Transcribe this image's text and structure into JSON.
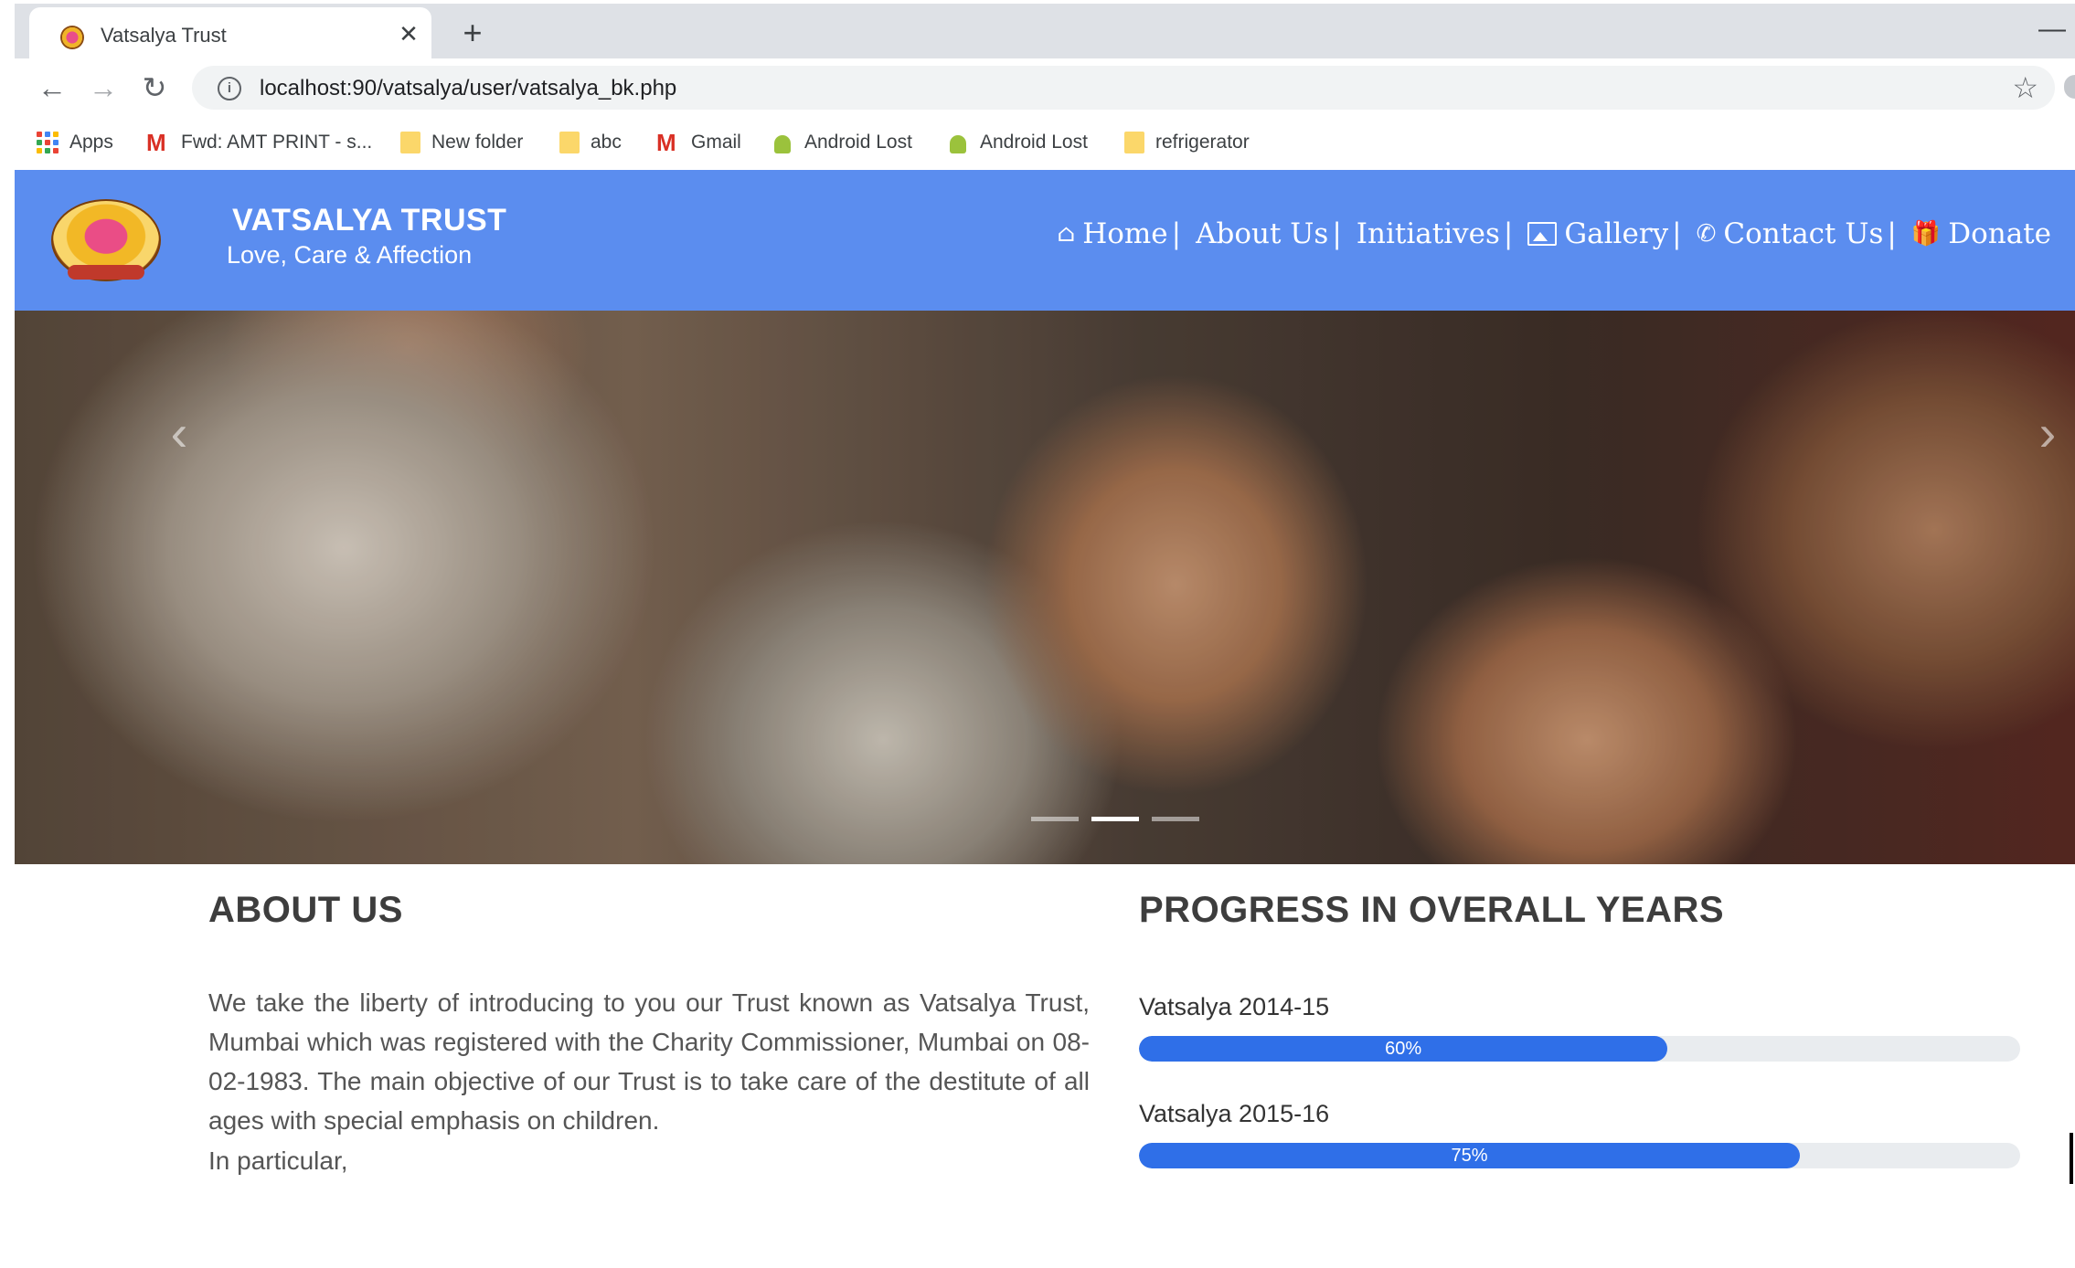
{
  "browser": {
    "tab_title": "Vatsalya Trust",
    "tab_close": "✕",
    "new_tab": "+",
    "minimize": "—",
    "url": "localhost:90/vatsalya/user/vatsalya_bk.php",
    "info": "i",
    "star": "☆",
    "nav": {
      "back": "←",
      "forward": "→",
      "reload": "↻"
    },
    "bookmarks": [
      {
        "label": "Apps",
        "icon": "apps-grid-icon"
      },
      {
        "label": "Fwd: AMT PRINT - s...",
        "icon": "gmail-icon"
      },
      {
        "label": "New folder",
        "icon": "folder-icon"
      },
      {
        "label": "abc",
        "icon": "folder-icon"
      },
      {
        "label": "Gmail",
        "icon": "gmail-icon"
      },
      {
        "label": "Android Lost",
        "icon": "android-icon"
      },
      {
        "label": "Android Lost",
        "icon": "android-icon"
      },
      {
        "label": "refrigerator",
        "icon": "folder-icon"
      }
    ]
  },
  "site": {
    "brand_title": "VATSALYA TRUST",
    "brand_tagline": "Love, Care & Affection",
    "brand_color": "#5b8def",
    "nav": [
      {
        "label": "Home",
        "icon": "home-icon",
        "glyph": "⌂",
        "separator": "|"
      },
      {
        "label": "About Us",
        "icon": "",
        "glyph": "",
        "separator": "|"
      },
      {
        "label": "Initiatives",
        "icon": "",
        "glyph": "",
        "separator": "|"
      },
      {
        "label": "Gallery",
        "icon": "picture-icon",
        "glyph": "",
        "separator": "|"
      },
      {
        "label": "Contact Us",
        "icon": "phone-icon",
        "glyph": "✆",
        "separator": "|"
      },
      {
        "label": "Donate",
        "icon": "gift-icon",
        "glyph": "🎁",
        "separator": ""
      }
    ]
  },
  "hero": {
    "prev_arrow": "‹",
    "next_arrow": "›",
    "slides": 3,
    "active_slide": 2
  },
  "about": {
    "heading": "ABOUT US",
    "body": "We take the liberty of introducing to you our Trust known as Vatsalya Trust, Mumbai which was registered with the Charity Commissioner, Mumbai on 08-02-1983. The main objective of our Trust is to take care of the destitute of all ages with special emphasis on children.",
    "extra": "In particular,"
  },
  "progress": {
    "heading": "PROGRESS IN OVERALL YEARS",
    "bar_color": "#2f6fe8",
    "items": [
      {
        "label": "Vatsalya 2014-15",
        "percent": 60,
        "text": "60%"
      },
      {
        "label": "Vatsalya 2015-16",
        "percent": 75,
        "text": "75%"
      }
    ]
  }
}
